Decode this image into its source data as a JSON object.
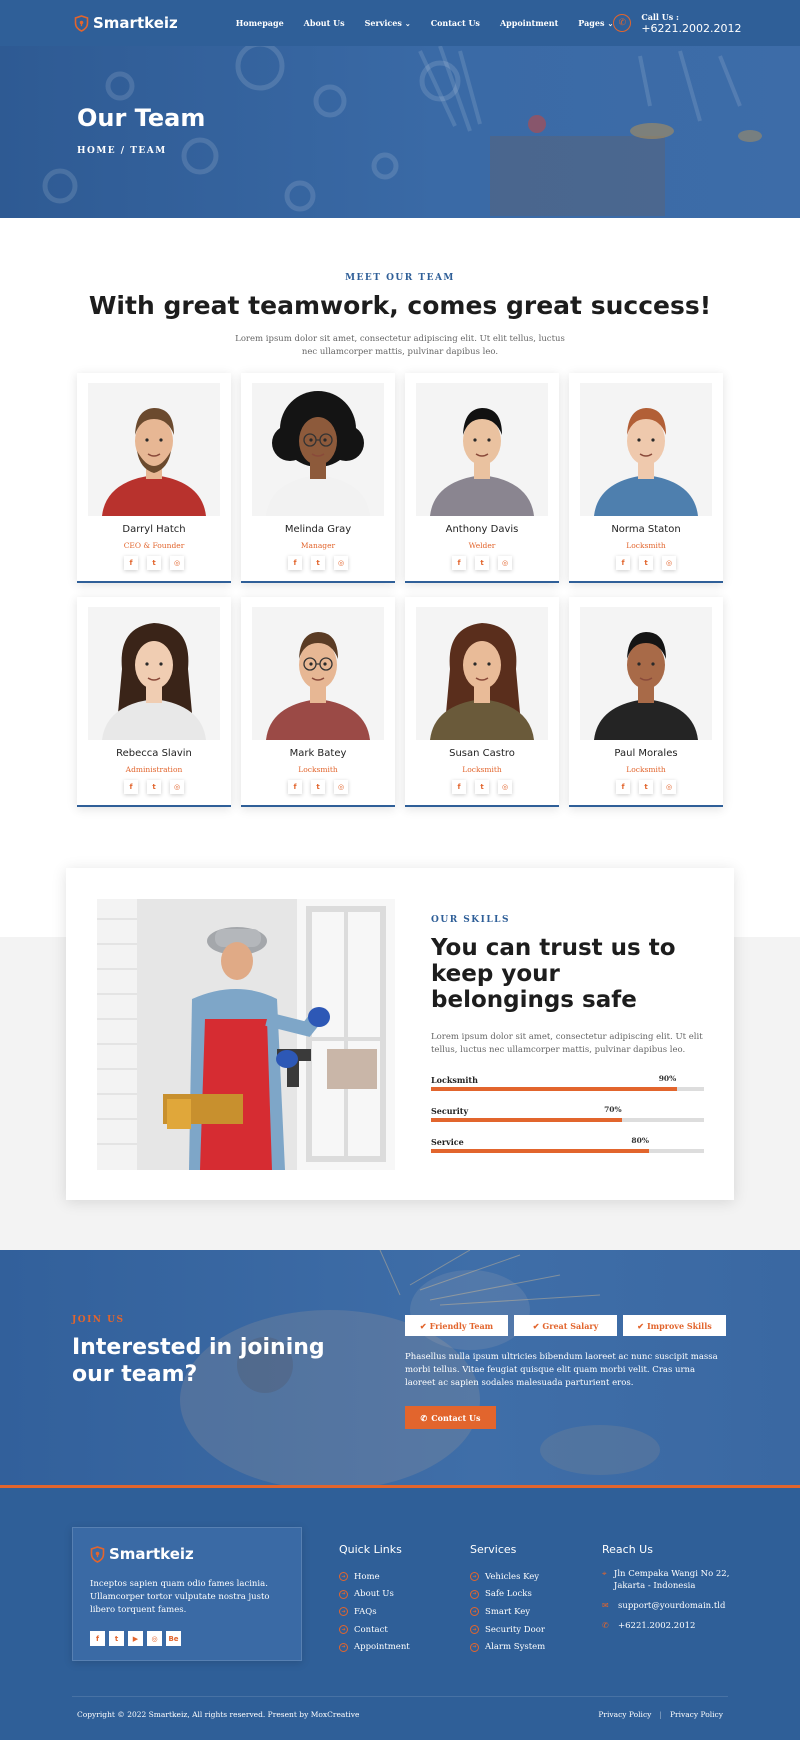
{
  "header": {
    "brand": "Smartkeiz",
    "nav": [
      {
        "label": "Homepage",
        "dropdown": false
      },
      {
        "label": "About Us",
        "dropdown": false
      },
      {
        "label": "Services",
        "dropdown": true
      },
      {
        "label": "Contact Us",
        "dropdown": false
      },
      {
        "label": "Appointment",
        "dropdown": false
      },
      {
        "label": "Pages",
        "dropdown": true
      }
    ],
    "call_label": "Call Us :",
    "call_number": "+6221.2002.2012"
  },
  "hero": {
    "title": "Our Team",
    "breadcrumb": "HOME / TEAM"
  },
  "team": {
    "eyebrow": "MEET OUR TEAM",
    "title": "With great teamwork, comes great success!",
    "subtitle": "Lorem ipsum dolor sit amet, consectetur adipiscing elit. Ut elit tellus, luctus nec ullamcorper mattis, pulvinar dapibus leo.",
    "members": [
      {
        "name": "Darryl Hatch",
        "role": "CEO & Founder",
        "skin": "#e7b794",
        "hair": "#6b4a2e",
        "shirt": "#b8322d",
        "bg": "#f4f4f4",
        "beard": true
      },
      {
        "name": "Melinda Gray",
        "role": "Manager",
        "skin": "#8d5a3b",
        "hair": "#141414",
        "shirt": "#f2f2f2",
        "bg": "#f4f4f4",
        "curly": true
      },
      {
        "name": "Anthony Davis",
        "role": "Welder",
        "skin": "#eac2a0",
        "hair": "#111111",
        "shirt": "#8a8590",
        "bg": "#f4f4f4"
      },
      {
        "name": "Norma Staton",
        "role": "Locksmith",
        "skin": "#efc9ad",
        "hair": "#b25f36",
        "shirt": "#4e7fae",
        "bg": "#f4f4f4"
      },
      {
        "name": "Rebecca Slavin",
        "role": "Administration",
        "skin": "#f0cdb2",
        "hair": "#3a2418",
        "shirt": "#e8e8e8",
        "bg": "#f4f4f4",
        "longhair": true
      },
      {
        "name": "Mark Batey",
        "role": "Locksmith",
        "skin": "#e7b794",
        "hair": "#5a3b24",
        "shirt": "#9b4a46",
        "bg": "#f4f4f4",
        "glasses": true
      },
      {
        "name": "Susan Castro",
        "role": "Locksmith",
        "skin": "#e9bb98",
        "hair": "#5a2e1c",
        "shirt": "#6a5a3a",
        "bg": "#f4f4f4",
        "longhair": true
      },
      {
        "name": "Paul Morales",
        "role": "Locksmith",
        "skin": "#a86a48",
        "hair": "#141414",
        "shirt": "#242424",
        "bg": "#f4f4f4"
      }
    ],
    "social_icons": [
      "f",
      "t",
      "ig"
    ]
  },
  "skills": {
    "eyebrow": "OUR SKILLS",
    "title": "You can trust us to keep your belongings safe",
    "text": "Lorem ipsum dolor sit amet, consectetur adipiscing elit. Ut elit tellus, luctus nec ullamcorper mattis, pulvinar dapibus leo.",
    "bars": [
      {
        "label": "Locksmith",
        "percent": 90,
        "percent_label": "90%"
      },
      {
        "label": "Security",
        "percent": 70,
        "percent_label": "70%"
      },
      {
        "label": "Service",
        "percent": 80,
        "percent_label": "80%"
      }
    ]
  },
  "join": {
    "eyebrow": "JOIN US",
    "title": "Interested in joining our team?",
    "tags": [
      "Friendly Team",
      "Great Salary",
      "Improve Skills"
    ],
    "text": "Phasellus nulla ipsum ultricies bibendum laoreet ac nunc suscipit massa morbi tellus. Vitae feugiat quisque elit quam morbi velit. Cras urna laoreet ac sapien sodales malesuada parturient eros.",
    "button": "Contact Us"
  },
  "footer": {
    "brand": "Smartkeiz",
    "description": "Inceptos sapien quam odio fames lacinia. Ullamcorper tortor vulputate nostra justo libero torquent fames.",
    "social": [
      "f",
      "t",
      "yt",
      "ig",
      "Be"
    ],
    "quick_links": {
      "title": "Quick Links",
      "items": [
        "Home",
        "About Us",
        "FAQs",
        "Contact",
        "Appointment"
      ]
    },
    "services": {
      "title": "Services",
      "items": [
        "Vehicles Key",
        "Safe Locks",
        "Smart Key",
        "Security Door",
        "Alarm System"
      ]
    },
    "reach": {
      "title": "Reach Us",
      "address": "Jln Cempaka Wangi No 22, Jakarta - Indonesia",
      "email": "support@yourdomain.tld",
      "phone": "+6221.2002.2012"
    },
    "copyright": "Copyright © 2022 Smartkeiz, All rights reserved. Present by MoxCreative",
    "links": [
      "Privacy Policy",
      "Privacy Policy"
    ]
  },
  "colors": {
    "primary": "#2f5f98",
    "accent": "#e2652d"
  }
}
